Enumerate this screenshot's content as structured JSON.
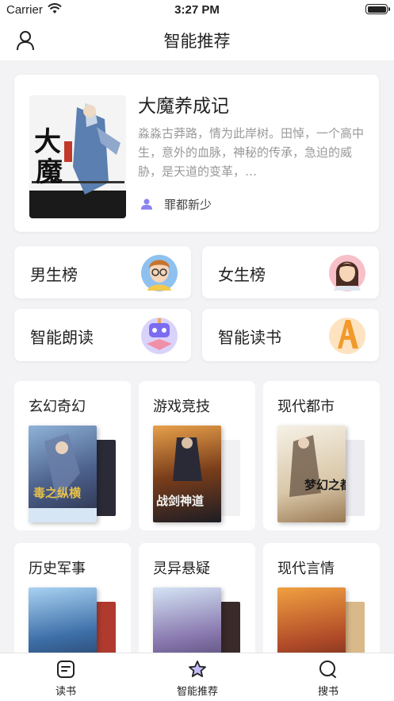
{
  "status_bar": {
    "carrier": "Carrier",
    "time": "3:27 PM"
  },
  "nav": {
    "title": "智能推荐",
    "user_icon": "user-icon"
  },
  "featured": {
    "title": "大魔养成记",
    "description": "淼淼古莽路，情为此岸树。田悼，一个高中生，意外的血脉，神秘的传承，急迫的威胁，是天道的变革，…",
    "author": "罪都新少",
    "cover_text": "大魔"
  },
  "categories": [
    {
      "label": "男生榜",
      "icon": "boy-avatar-icon"
    },
    {
      "label": "女生榜",
      "icon": "girl-avatar-icon"
    },
    {
      "label": "智能朗读",
      "icon": "robot-icon"
    },
    {
      "label": "智能读书",
      "icon": "letter-a-icon"
    }
  ],
  "genres": [
    {
      "label": "玄幻奇幻",
      "cover_text": "毒之纵横"
    },
    {
      "label": "游戏竞技",
      "cover_text": "战剑神道"
    },
    {
      "label": "现代都市",
      "cover_text": "梦幻之都"
    },
    {
      "label": "历史军事",
      "cover_text": ""
    },
    {
      "label": "灵异悬疑",
      "cover_text": ""
    },
    {
      "label": "现代言情",
      "cover_text": ""
    }
  ],
  "tabs": [
    {
      "label": "读书",
      "icon": "book-list-icon"
    },
    {
      "label": "智能推荐",
      "icon": "star-icon"
    },
    {
      "label": "搜书",
      "icon": "search-icon"
    }
  ],
  "colors": {
    "accent": "#7b6cf2",
    "text_secondary": "#999999",
    "background": "#f3f3f5"
  }
}
